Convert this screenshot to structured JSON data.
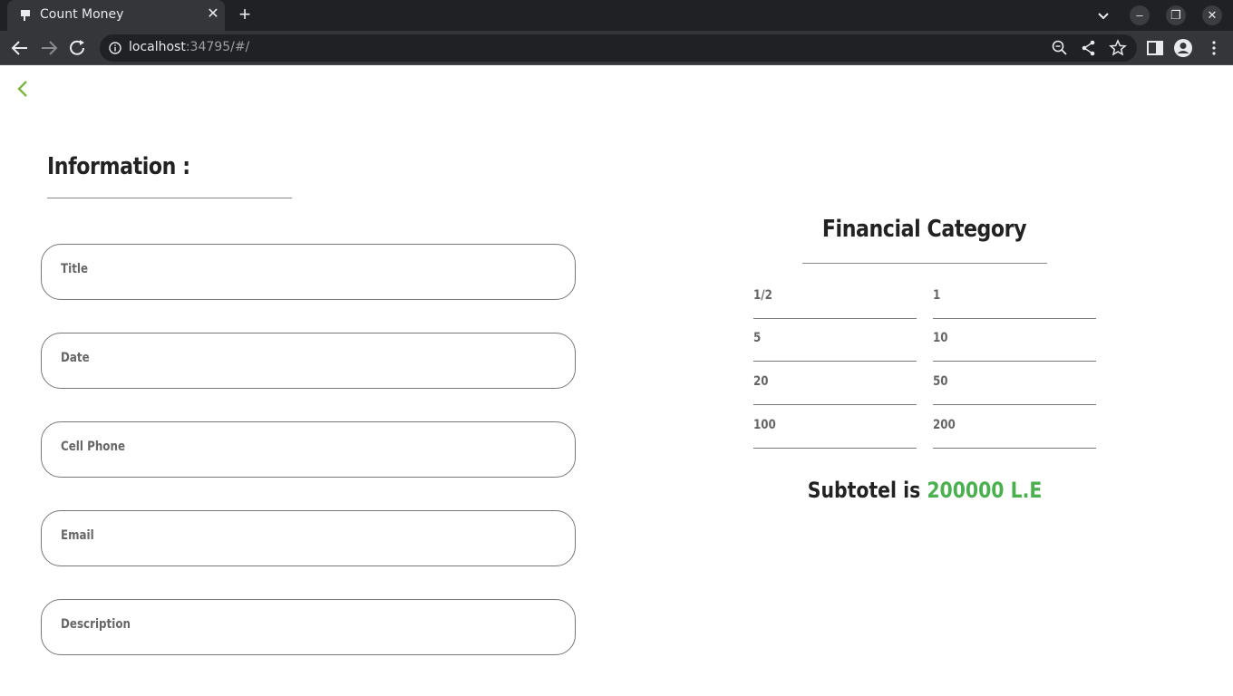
{
  "browser": {
    "tab_title": "Count Money",
    "url_host": "localhost",
    "url_rest": ":34795/#/"
  },
  "form": {
    "heading": "Information :",
    "fields": [
      {
        "label": "Title"
      },
      {
        "label": "Date"
      },
      {
        "label": "Cell Phone"
      },
      {
        "label": "Email"
      },
      {
        "label": "Description"
      }
    ]
  },
  "financial": {
    "heading": "Financial Category",
    "denominations": [
      "1/2",
      "1",
      "5",
      "10",
      "20",
      "50",
      "100",
      "200"
    ],
    "subtotal_prefix": "Subtotel is",
    "subtotal_amount": "200000 L.E",
    "accent_color": "#4caf50"
  }
}
